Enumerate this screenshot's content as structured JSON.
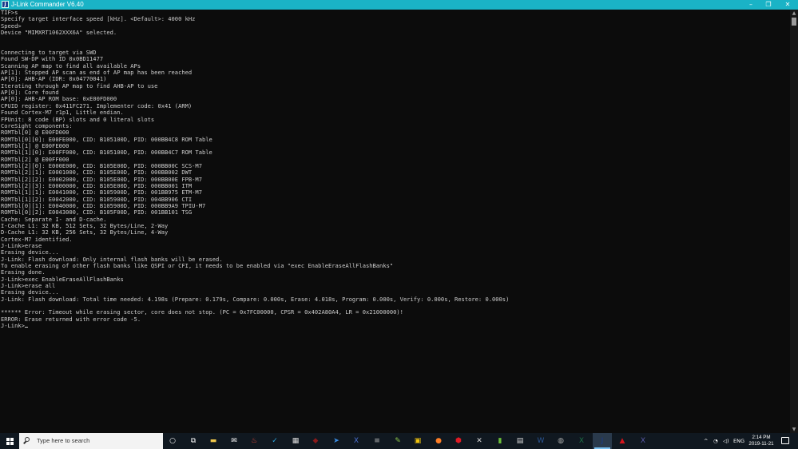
{
  "window": {
    "title": "J-Link Commander V6.40",
    "icon_label": "J",
    "controls": {
      "minimize": "–",
      "maximize": "❐",
      "close": "✕"
    }
  },
  "console": {
    "lines": [
      "TIF>s",
      "Specify target interface speed [kHz]. <Default>: 4000 kHz",
      "Speed>",
      "Device \"MIMXRT1062XXX6A\" selected.",
      "",
      "",
      "Connecting to target via SWD",
      "Found SW-DP with ID 0x0BD11477",
      "Scanning AP map to find all available APs",
      "AP[1]: Stopped AP scan as end of AP map has been reached",
      "AP[0]: AHB-AP (IDR: 0x04770041)",
      "Iterating through AP map to find AHB-AP to use",
      "AP[0]: Core found",
      "AP[0]: AHB-AP ROM base: 0xE00FD000",
      "CPUID register: 0x411FC271. Implementer code: 0x41 (ARM)",
      "Found Cortex-M7 r1p1, Little endian.",
      "FPUnit: 8 code (BP) slots and 0 literal slots",
      "CoreSight components:",
      "ROMTbl[0] @ E00FD000",
      "ROMTbl[0][0]: E00FE000, CID: B105100D, PID: 000BB4C8 ROM Table",
      "ROMTbl[1] @ E00FE000",
      "ROMTbl[1][0]: E00FF000, CID: B105100D, PID: 000BB4C7 ROM Table",
      "ROMTbl[2] @ E00FF000",
      "ROMTbl[2][0]: E000E000, CID: B105E00D, PID: 000BB00C SCS-M7",
      "ROMTbl[2][1]: E0001000, CID: B105E00D, PID: 000BB002 DWT",
      "ROMTbl[2][2]: E0002000, CID: B105E00D, PID: 000BB00E FPB-M7",
      "ROMTbl[2][3]: E0000000, CID: B105E00D, PID: 000BB001 ITM",
      "ROMTbl[1][1]: E0041000, CID: B105900D, PID: 001BB975 ETM-M7",
      "ROMTbl[1][2]: E0042000, CID: B105900D, PID: 004BB906 CTI",
      "ROMTbl[0][1]: E0040000, CID: B105900D, PID: 000BB9A9 TPIU-M7",
      "ROMTbl[0][2]: E0043000, CID: B105F00D, PID: 001BB101 TSG",
      "Cache: Separate I- and D-cache.",
      "I-Cache L1: 32 KB, 512 Sets, 32 Bytes/Line, 2-Way",
      "D-Cache L1: 32 KB, 256 Sets, 32 Bytes/Line, 4-Way",
      "Cortex-M7 identified.",
      "J-Link>erase",
      "Erasing device...",
      "J-Link: Flash download: Only internal flash banks will be erased.",
      "To enable erasing of other flash banks like QSPI or CFI, it needs to be enabled via \"exec EnableEraseAllFlashBanks\"",
      "Erasing done.",
      "J-Link>exec EnableEraseAllFlashBanks",
      "J-Link>erase all",
      "Erasing device...",
      "J-Link: Flash download: Total time needed: 4.198s (Prepare: 0.179s, Compare: 0.000s, Erase: 4.018s, Program: 0.000s, Verify: 0.000s, Restore: 0.000s)",
      "",
      "****** Error: Timeout while erasing sector, core does not stop. (PC = 0x7FC00000, CPSR = 0x402A80A4, LR = 0x21000000)!",
      "ERROR: Erase returned with error code -5."
    ],
    "prompt": "J-Link>"
  },
  "scrollbar": {
    "up": "▲",
    "down": "▼"
  },
  "taskbar": {
    "search_placeholder": "Type here to search",
    "apps": [
      {
        "name": "cortana-icon",
        "glyph": "○",
        "color": "#ffffff"
      },
      {
        "name": "task-view-icon",
        "glyph": "⧉",
        "color": "#ffffff"
      },
      {
        "name": "file-explorer-icon",
        "glyph": "▬",
        "color": "#f2c94c"
      },
      {
        "name": "mail-icon",
        "glyph": "✉",
        "color": "#ffffff"
      },
      {
        "name": "app-red-icon",
        "glyph": "♨",
        "color": "#e74c3c"
      },
      {
        "name": "app-blue-check-icon",
        "glyph": "✓",
        "color": "#2ea8e0"
      },
      {
        "name": "calculator-icon",
        "glyph": "▦",
        "color": "#dddddd"
      },
      {
        "name": "app-dark-red-icon",
        "glyph": "◆",
        "color": "#8b1a1a"
      },
      {
        "name": "app-blue-arrow-icon",
        "glyph": "➤",
        "color": "#3a8ee6"
      },
      {
        "name": "app-x-blue-icon",
        "glyph": "X",
        "color": "#4a6fd1"
      },
      {
        "name": "app-stack-icon",
        "glyph": "≡",
        "color": "#bbbbbb"
      },
      {
        "name": "app-green-icon",
        "glyph": "✎",
        "color": "#8bc34a"
      },
      {
        "name": "app-yellow-icon",
        "glyph": "▣",
        "color": "#f1c40f"
      },
      {
        "name": "firefox-icon",
        "glyph": "●",
        "color": "#ff7f27"
      },
      {
        "name": "app-red-cube-icon",
        "glyph": "⬢",
        "color": "#e01b24"
      },
      {
        "name": "tools-icon",
        "glyph": "✕",
        "color": "#dddddd"
      },
      {
        "name": "app-green-doc-icon",
        "glyph": "▮",
        "color": "#6cbf3a"
      },
      {
        "name": "app-doc-icon",
        "glyph": "▤",
        "color": "#dddddd"
      },
      {
        "name": "word-icon",
        "glyph": "W",
        "color": "#2b5797"
      },
      {
        "name": "app-globe-icon",
        "glyph": "◍",
        "color": "#aaaaaa"
      },
      {
        "name": "excel-icon",
        "glyph": "X",
        "color": "#1e7145"
      },
      {
        "name": "jlink-icon",
        "glyph": "J",
        "color": "#1a3b8c"
      },
      {
        "name": "acrobat-icon",
        "glyph": "▲",
        "color": "#d4151c"
      },
      {
        "name": "app-x-purple-icon",
        "glyph": "X",
        "color": "#5a5aa8"
      }
    ],
    "tray": {
      "chevron": "^",
      "network": "◔",
      "volume": "◁)",
      "language": "ENG",
      "time": "2:14 PM",
      "date": "2019-11-21"
    }
  }
}
